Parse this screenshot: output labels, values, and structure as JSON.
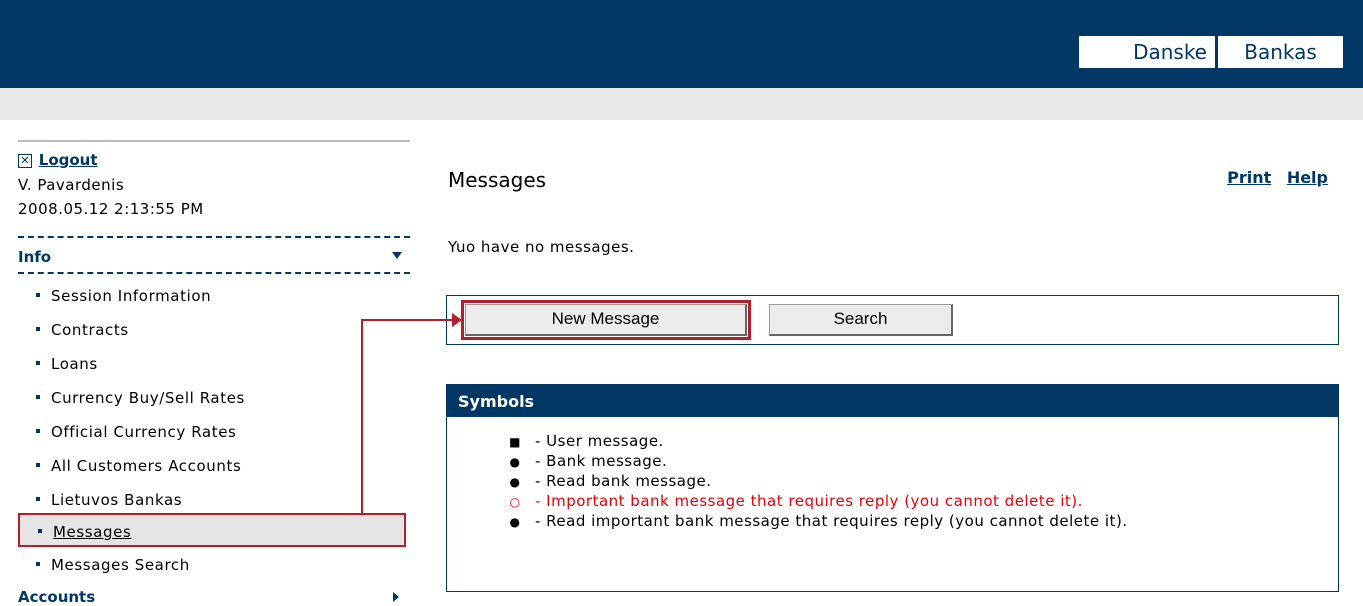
{
  "header": {
    "logo_part1": "Danske",
    "logo_part2": "Bankas",
    "brand_color": "#003764"
  },
  "sidebar": {
    "logout_icon": "close-box-icon",
    "logout_label": "Logout",
    "user_name": "V. Pavardenis",
    "timestamp": "2008.05.12 2:13:55 PM",
    "info_section": "Info",
    "items": [
      {
        "label": "Session Information"
      },
      {
        "label": "Contracts"
      },
      {
        "label": "Loans"
      },
      {
        "label": "Currency Buy/Sell Rates"
      },
      {
        "label": "Official Currency Rates"
      },
      {
        "label": "All Customers Accounts"
      },
      {
        "label": "Lietuvos Bankas"
      },
      {
        "label": "Messages",
        "active": true
      },
      {
        "label": "Messages Search"
      }
    ],
    "accounts_section": "Accounts"
  },
  "main": {
    "title": "Messages",
    "print_label": "Print",
    "help_label": "Help",
    "no_messages": "Yuo have no messages.",
    "new_message_button": "New Message",
    "search_button": "Search",
    "symbols": {
      "title": "Symbols",
      "rows": [
        {
          "symbol": "■",
          "text": "- User message."
        },
        {
          "symbol": "●",
          "text": "- Bank message."
        },
        {
          "symbol": "●",
          "text": "- Read bank message."
        },
        {
          "symbol": "○",
          "text": "- Important bank message that requires reply (you cannot delete it)."
        },
        {
          "symbol": "●",
          "text": "- Read important bank message that requires reply (you cannot delete it)."
        }
      ]
    }
  },
  "highlight_color": "#b41f2d",
  "important_color": "#e8000b"
}
